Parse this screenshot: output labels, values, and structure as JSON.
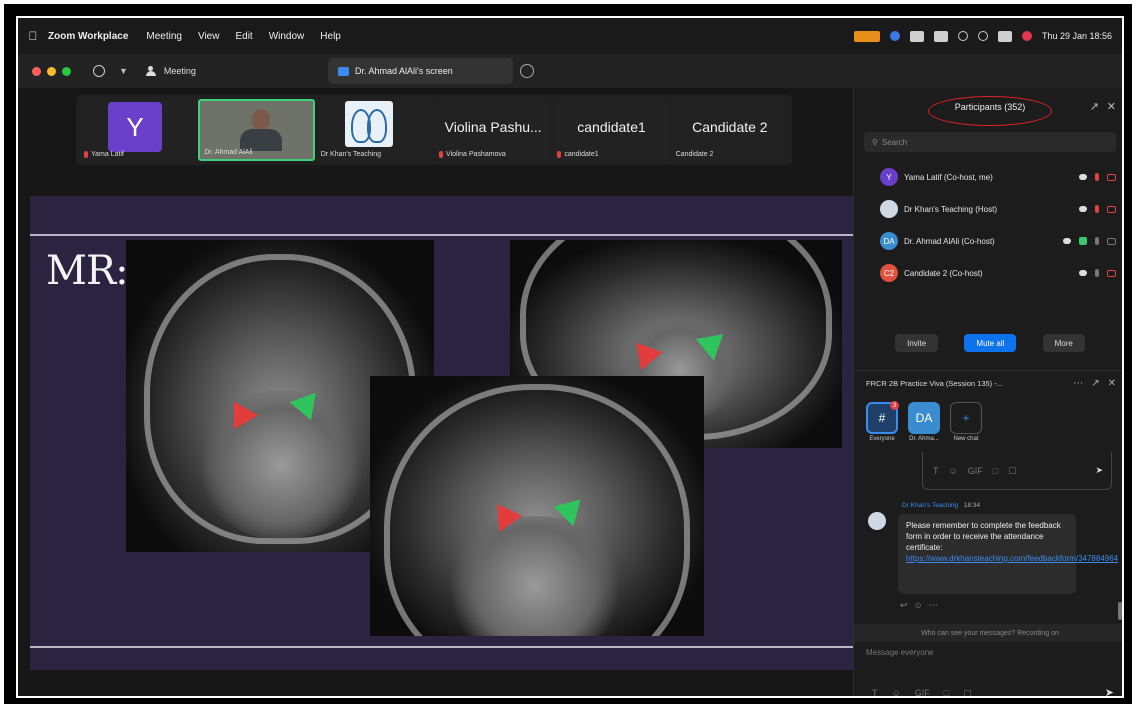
{
  "menubar": {
    "app": "Zoom Workplace",
    "items": [
      "Meeting",
      "View",
      "Edit",
      "Window",
      "Help"
    ],
    "clock": "Thu 29 Jan 18:56"
  },
  "titlebar": {
    "meeting": "Meeting",
    "share_tab": "Dr. Ahmad AlAli's screen"
  },
  "thumbnails": [
    {
      "name": "Yama Latif",
      "initial": "Y",
      "type": "avatar"
    },
    {
      "name": "Dr. Ahmad AlAli",
      "type": "video"
    },
    {
      "name": "Dr Khan's Teaching",
      "type": "logo"
    },
    {
      "name": "Violina Pashamova",
      "display": "Violina Pashu...",
      "type": "text"
    },
    {
      "name": "candidate1",
      "display": "candidate1",
      "type": "text"
    },
    {
      "name": "Candidate 2",
      "display": "Candidate 2",
      "type": "text"
    }
  ],
  "slide": {
    "title": "MR:"
  },
  "participants": {
    "header": "Participants (352)",
    "search_placeholder": "Search",
    "list": [
      {
        "name": "Yama Latif (Co-host, me)",
        "initials": "Y",
        "color": "#6a3fc9"
      },
      {
        "name": "Dr Khan's Teaching (Host)",
        "initials": "",
        "color": "#cfd9e4"
      },
      {
        "name": "Dr. Ahmad AlAli (Co-host)",
        "initials": "DA",
        "color": "#3a8cd0"
      },
      {
        "name": "Candidate 2 (Co-host)",
        "initials": "C2",
        "color": "#e0503c"
      }
    ],
    "buttons": {
      "invite": "Invite",
      "mute_all": "Mute all",
      "more": "More"
    }
  },
  "chat": {
    "title": "FRCR 2B Practice Viva (Session 135) -...",
    "tiles": [
      {
        "label": "Everyone",
        "glyph": "#",
        "badge": "3"
      },
      {
        "label": "Dr. Ahma...",
        "glyph": "DA"
      },
      {
        "label": "New chat",
        "glyph": "+"
      }
    ],
    "message": {
      "sender": "Dr Khan's Teaching",
      "time": "18:34",
      "text": "Please remember to complete the feedback form in order to receive the attendance certificate:",
      "link": "https://www.drkhansteaching.com/feedbackform/347884964"
    },
    "notice": "Who can see your messages? Recording on",
    "input_placeholder": "Message everyone"
  },
  "colors": {
    "accent": "#0e72ed",
    "annotation": "#dd2222",
    "slide_bg": "#2a2441",
    "arrow_red": "#e23c3c",
    "arrow_green": "#2fc45c"
  }
}
